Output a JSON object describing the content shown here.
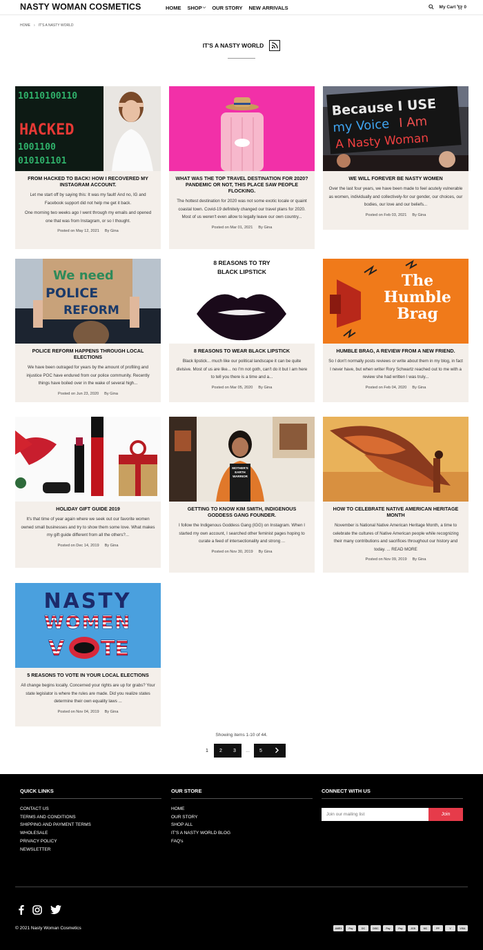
{
  "header": {
    "logo": "NASTY WOMAN COSMETICS",
    "nav": [
      {
        "label": "HOME",
        "caret": false
      },
      {
        "label": "SHOP",
        "caret": true
      },
      {
        "label": "OUR STORY",
        "caret": false
      },
      {
        "label": "NEW ARRIVALS",
        "caret": false
      }
    ],
    "cart_label": "My Cart",
    "cart_count": "0"
  },
  "breadcrumb": [
    "HOME",
    "IT'S A NASTY WORLD"
  ],
  "page_title": "IT'S A NASTY WORLD",
  "posts": [
    {
      "title": "FROM HACKED TO BACK! HOW I RECOVERED MY INSTAGRAM ACCOUNT.",
      "excerpt": [
        "Let me start off by saying this: It was my fault! And no, IG and Facebook support did not help me get it back.",
        "One morning two weeks ago I went through my emails and opened one that was from Instagram, or so I thought."
      ],
      "date": "Posted on May 12, 2021",
      "author": "By Gina",
      "image": "hacked"
    },
    {
      "title": "WHAT WAS THE TOP TRAVEL DESTINATION FOR 2020? PANDEMIC OR NOT, THIS PLACE SAW PEOPLE FLOCKING.",
      "excerpt": [
        "The hottest destination for 2020 was not some exotic locale or quaint coastal town.  Covid-19 definitely changed our travel plans for 2020.  Most of us weren't even allow to legally leave our own country..."
      ],
      "date": "Posted on Mar 01, 2021",
      "author": "By Gina",
      "image": "suitcase"
    },
    {
      "title": "WE WILL FOREVER BE NASTY WOMEN",
      "excerpt": [
        "Over the last four years, we have been made to feel acutely vulnerable as women, individually and collectively-for our gender, our choices, our bodies,  our love and our beliefs..."
      ],
      "date": "Posted on Feb 03, 2021",
      "author": "By Gina",
      "image": "protest-sign"
    },
    {
      "title": "POLICE REFORM HAPPENS THROUGH LOCAL ELECTIONS",
      "excerpt": [
        "We have been outraged for years by the amount of profiling and injustice POC have endured from our police community.  Recently things have boiled over in the wake of several high..."
      ],
      "date": "Posted on Jun 23, 2020",
      "author": "By Gina",
      "image": "police-reform"
    },
    {
      "title": "8 REASONS TO WEAR BLACK LIPSTICK",
      "excerpt": [
        "Black lipstick... much like our political landscape it can be quite divisive.  Most of us are like... no I'm not goth, can't do it but I am here to tell you there is a time and a..."
      ],
      "date": "Posted on Mar 05, 2020",
      "author": "By Gina",
      "image": "black-lips",
      "image_caption": "8 REASONS TO TRY BLACK LIPSTICK"
    },
    {
      "title": "HUMBLE BRAG, A REVIEW FROM A NEW FRIEND.",
      "excerpt": [
        "So I don't normally posts reviews or write about them in my blog, in fact I never have, but when writer Rory Schwartz reached out to me with a review she had written I was truly..."
      ],
      "date": "Posted on Feb 04, 2020",
      "author": "By Gina",
      "image": "humble-brag",
      "image_caption": "The Humble Brag"
    },
    {
      "title": "HOLIDAY GIFT GUIDE 2019",
      "excerpt": [
        "It's that time of year again where we seek out our favorite women owned small businesses and try to show them some love.  What makes my gift guide different from all the others?..."
      ],
      "date": "Posted on Dec 14, 2019",
      "author": "By Gina",
      "image": "gift"
    },
    {
      "title": "GETTING TO KNOW KIM SMITH, INDIGENOUS GODDESS GANG FOUNDER.",
      "excerpt": [
        "I follow the Indigenous Goddess Gang (IGG) on Instagram.  When I started my own account, I searched other feminist pages hoping to curate a feed of intersectionality and strong ..."
      ],
      "date": "Posted on Nov 30, 2019",
      "author": "By Gina",
      "image": "kim-smith",
      "image_caption": "MOTHER'S EARTH WARRIOR"
    },
    {
      "title": "HOW TO CELEBRATE NATIVE AMERICAN HERITAGE MONTH",
      "excerpt": [
        "November is National Native American Heritage Month, a time to celebrate the cultures of Native American people while recognizing their many contributions and sacrifices throughout our history and today. ... READ MORE"
      ],
      "date": "Posted on Nov 09, 2019",
      "author": "By Gina",
      "image": "wings"
    },
    {
      "title": "5 REASONS TO VOTE IN YOUR LOCAL ELECTIONS",
      "excerpt": [
        "All change begins locally.  Concerned your rights are up for grabs? Your state legislator is where the rules are made.  Did you realize states determine their own equality laws ..."
      ],
      "date": "Posted on Nov 04, 2019",
      "author": "By Gina",
      "image": "vote"
    }
  ],
  "pagination": {
    "info": "Showing items 1-10 of 44.",
    "pages": [
      "1",
      "2",
      "3",
      "...",
      "5"
    ],
    "current": "1"
  },
  "footer": {
    "quick_links_title": "QUICK LINKS",
    "quick_links": [
      "CONTACT US",
      "TERMS AND CONDITIONS",
      "SHIPPING AND PAYMENT TERMS",
      "WHOLESALE",
      "PRIVACY POLICY",
      "NEWSLETTER"
    ],
    "store_title": "OUR STORE",
    "store_links": [
      "HOME",
      "OUR STORY",
      "SHOP ALL",
      "IT'S A NASTY WORLD BLOG",
      "FAQ's"
    ],
    "connect_title": "CONNECT WITH US",
    "mail_placeholder": "Join our mailing list",
    "join_label": "Join",
    "copyright": "© 2021 Nasty Woman Cosmetics",
    "payments": [
      "AMEX",
      "Pay",
      "DC",
      "DISC",
      "Pay",
      "Pay",
      "JCB",
      "MC",
      "PP",
      "V",
      "VISA"
    ]
  },
  "colors": {
    "accent": "#e63b4a",
    "card_bg": "#f4efea",
    "footer_bg": "#000000"
  }
}
